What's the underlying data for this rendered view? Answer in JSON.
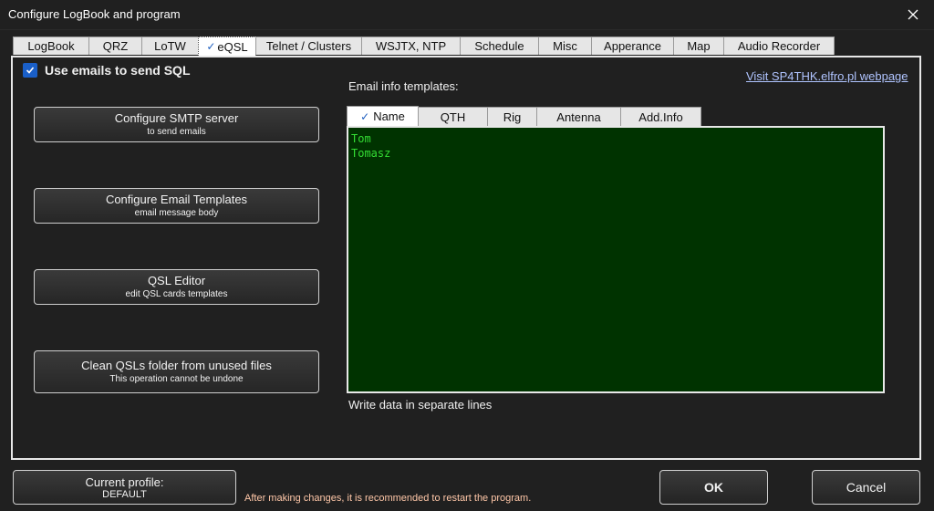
{
  "window": {
    "title": "Configure LogBook and program"
  },
  "tabs": [
    {
      "label": "LogBook",
      "width": 84
    },
    {
      "label": "QRZ",
      "width": 59
    },
    {
      "label": "LoTW",
      "width": 63
    },
    {
      "label": "eQSL",
      "width": 64,
      "active": true
    },
    {
      "label": "Telnet / Clusters",
      "width": 117
    },
    {
      "label": "WSJTX, NTP",
      "width": 109
    },
    {
      "label": "Schedule",
      "width": 87
    },
    {
      "label": "Misc",
      "width": 59
    },
    {
      "label": "Apperance",
      "width": 91
    },
    {
      "label": "Map",
      "width": 56
    },
    {
      "label": "Audio Recorder",
      "width": 122
    }
  ],
  "eqsl": {
    "use_emails_label": "Use emails to send SQL",
    "use_emails_checked": true,
    "visit_link": "Visit SP4THK.elfro.pl webpage",
    "buttons": [
      {
        "line1": "Configure SMTP server",
        "line2": "to send emails"
      },
      {
        "line1": "Configure Email Templates",
        "line2": "email message body"
      },
      {
        "line1": "QSL Editor",
        "line2": "edit QSL cards templates"
      },
      {
        "line1": "Clean QSLs folder from unused files",
        "line2": "This operation cannot be undone"
      }
    ],
    "templates_label": "Email info templates:",
    "subtabs": [
      {
        "label": "Name",
        "width": 79,
        "active": true
      },
      {
        "label": "QTH",
        "width": 77
      },
      {
        "label": "Rig",
        "width": 55
      },
      {
        "label": "Antenna",
        "width": 93
      },
      {
        "label": "Add.Info",
        "width": 89
      }
    ],
    "template_lines": [
      "Tom",
      "Tomasz"
    ],
    "hint": "Write data in separate lines"
  },
  "footer": {
    "profile_label": "Current profile:",
    "profile_value": "DEFAULT",
    "restart_note": "After making changes, it is recommended to restart the program.",
    "ok_label": "OK",
    "cancel_label": "Cancel"
  }
}
